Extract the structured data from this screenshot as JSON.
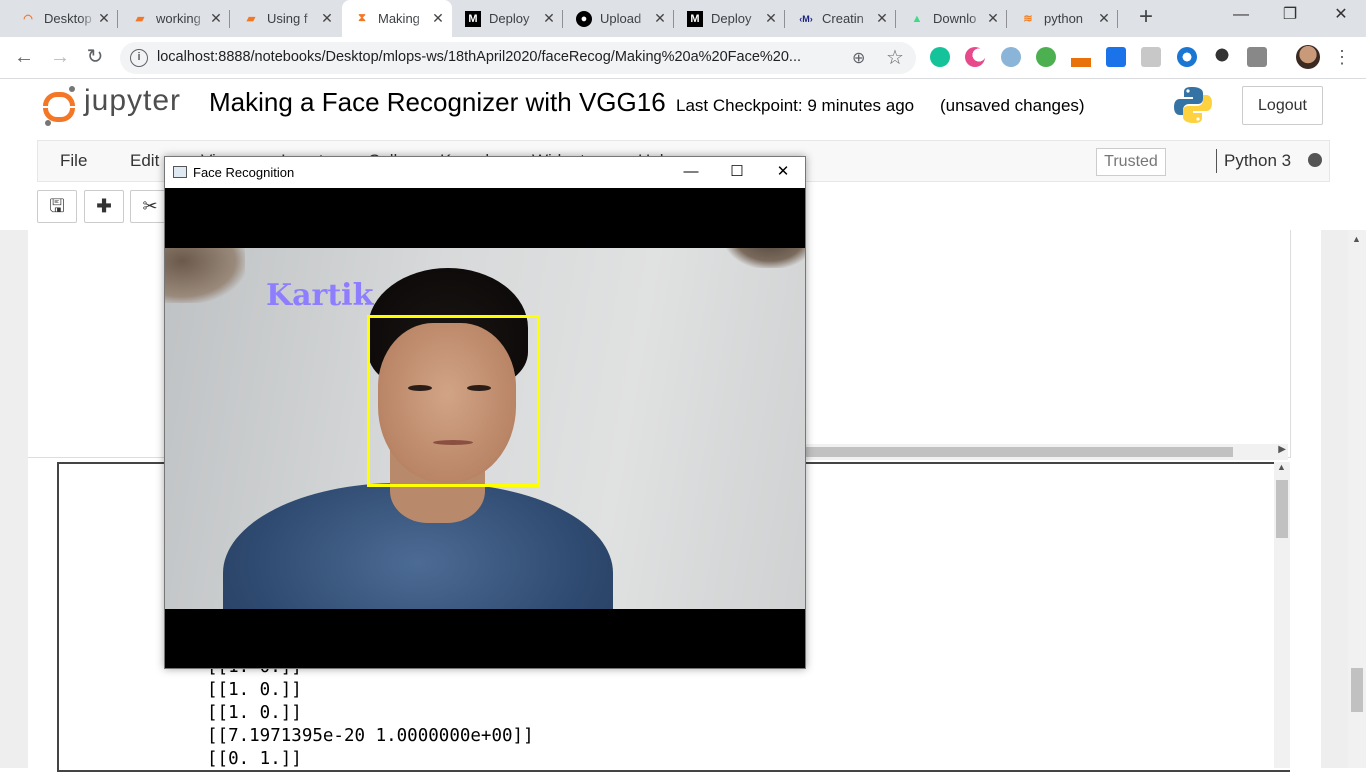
{
  "browser": {
    "tabs": [
      {
        "label": "Desktop",
        "icon": "jupyter-icon",
        "color": "#f37726"
      },
      {
        "label": "working",
        "icon": "notebook-icon",
        "color": "#f37726"
      },
      {
        "label": "Using f",
        "icon": "notebook-icon",
        "color": "#f37726"
      },
      {
        "label": "Making",
        "icon": "hourglass-icon",
        "color": "#f37726",
        "active": true
      },
      {
        "label": "Deploy",
        "icon": "medium-icon",
        "color": "#000000"
      },
      {
        "label": "Upload",
        "icon": "github-icon",
        "color": "#000000"
      },
      {
        "label": "Deploy",
        "icon": "medium-icon",
        "color": "#000000"
      },
      {
        "label": "Creatin",
        "icon": "mlops-icon",
        "color": "#1a237e"
      },
      {
        "label": "Downlo",
        "icon": "android-icon",
        "color": "#3ddc84"
      },
      {
        "label": "python",
        "icon": "stackoverflow-icon",
        "color": "#f48024"
      }
    ],
    "url": "localhost:8888/notebooks/Desktop/mlops-ws/18thApril2020/faceRecog/Making%20a%20Face%20..."
  },
  "jupyter": {
    "logo_text": "jupyter",
    "notebook_title": "Making a Face Recognizer with VGG16",
    "checkpoint": "Last Checkpoint: 9 minutes ago",
    "status": "(unsaved changes)",
    "logout_label": "Logout",
    "menu": [
      "File",
      "Edit",
      "View",
      "Insert",
      "Cell",
      "Kernel",
      "Widgets",
      "Help"
    ],
    "trusted_label": "Trusted",
    "kernel_name": "Python 3"
  },
  "output_lines": [
    "[[1. 0.]]",
    "[[1. 0.]]",
    "[[1. 0.]]",
    "[[7.1971395e-20 1.0000000e+00]]",
    "[[0. 1.]]"
  ],
  "face_window": {
    "title": "Face Recognition",
    "detected_name": "Kartik",
    "box_color": "#ffff00",
    "label_color": "#8f7dff"
  }
}
